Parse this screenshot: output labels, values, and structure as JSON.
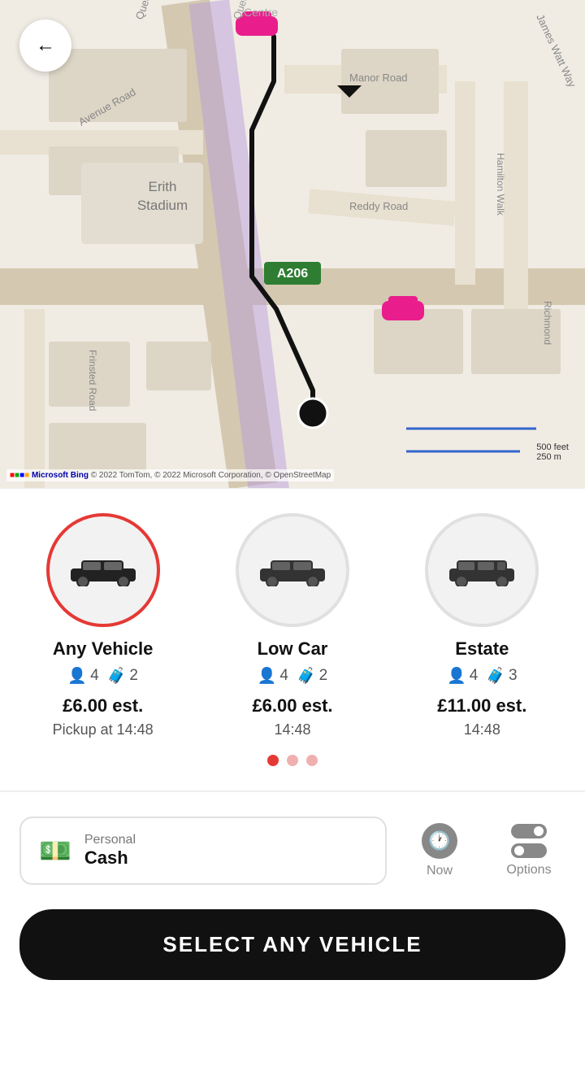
{
  "map": {
    "attribution": "© 2022 TomTom, © 2022 Microsoft Corporation, © OpenStreetMap",
    "scale_feet": "500 feet",
    "scale_m": "250 m",
    "bing_logo": "Microsoft Bing"
  },
  "back_button": {
    "label": "←"
  },
  "vehicles": [
    {
      "name": "Any Vehicle",
      "selected": true,
      "passengers": "4",
      "bags": "2",
      "price": "£6.00 est.",
      "time_label": "Pickup at 14:48"
    },
    {
      "name": "Low Car",
      "selected": false,
      "passengers": "4",
      "bags": "2",
      "price": "£6.00 est.",
      "time_label": "14:48"
    },
    {
      "name": "Estate",
      "selected": false,
      "passengers": "4",
      "bags": "3",
      "price": "£11.00 est.",
      "time_label": "14:48"
    }
  ],
  "dots": [
    {
      "active": true
    },
    {
      "active": false
    },
    {
      "active": false
    }
  ],
  "payment": {
    "label": "Personal",
    "type": "Cash"
  },
  "now_button": {
    "label": "Now"
  },
  "options_button": {
    "label": "Options"
  },
  "select_button": {
    "label": "SELECT ANY VEHICLE"
  }
}
